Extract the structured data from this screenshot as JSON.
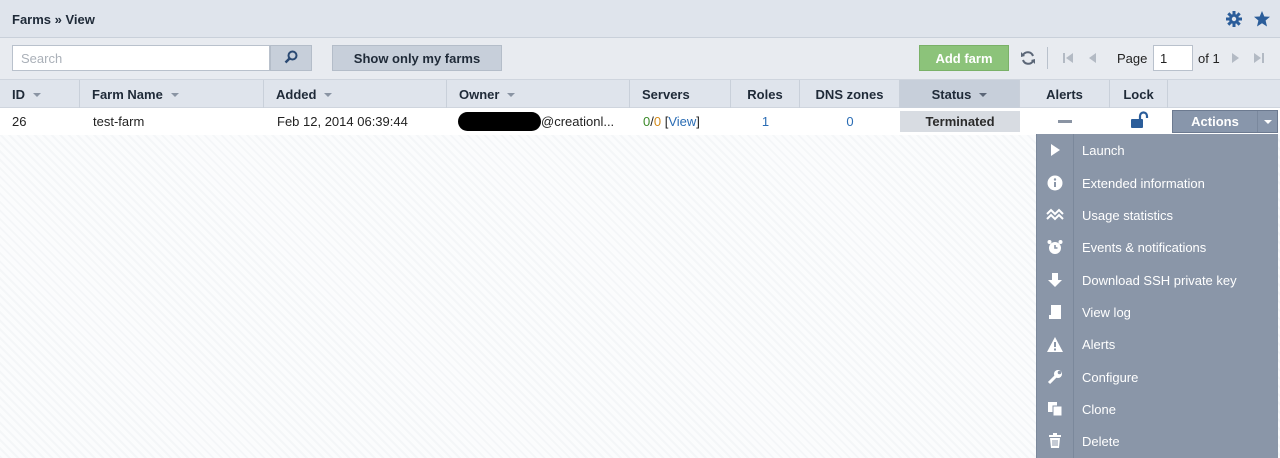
{
  "header": {
    "title": "Farms » View"
  },
  "toolbar": {
    "search_placeholder": "Search",
    "show_my_farms_label": "Show only my farms",
    "add_farm_label": "Add farm",
    "page_label": "Page",
    "page_value": "1",
    "of_label": "of 1"
  },
  "columns": {
    "id": "ID",
    "farm_name": "Farm Name",
    "added": "Added",
    "owner": "Owner",
    "servers": "Servers",
    "roles": "Roles",
    "dns_zones": "DNS zones",
    "status": "Status",
    "alerts": "Alerts",
    "lock": "Lock"
  },
  "rows": [
    {
      "id": "26",
      "farm_name": "test-farm",
      "added": "Feb 12, 2014 06:39:44",
      "owner_suffix": "@creationl...",
      "servers_running": "0",
      "servers_sep": "/",
      "servers_total": "0",
      "view_open": "[",
      "view_link": "View",
      "view_close": "]",
      "roles": "1",
      "dns_zones": "0",
      "status": "Terminated",
      "actions_label": "Actions"
    }
  ],
  "menu": {
    "items": [
      {
        "label": "Launch",
        "icon": "play-icon"
      },
      {
        "label": "Extended information",
        "icon": "info-icon"
      },
      {
        "label": "Usage statistics",
        "icon": "chart-icon"
      },
      {
        "label": "Events & notifications",
        "icon": "alarm-clock-icon"
      },
      {
        "label": "Download SSH private key",
        "icon": "download-icon"
      },
      {
        "label": "View log",
        "icon": "log-icon"
      },
      {
        "label": "Alerts",
        "icon": "warning-icon"
      },
      {
        "label": "Configure",
        "icon": "wrench-icon"
      },
      {
        "label": "Clone",
        "icon": "copy-icon"
      },
      {
        "label": "Delete",
        "icon": "trash-icon"
      }
    ]
  },
  "colors": {
    "accent_green": "#8cc37a",
    "menu_bg": "#8a96a8",
    "link_blue": "#2a6cb4",
    "header_bg": "#dfe4ec"
  }
}
